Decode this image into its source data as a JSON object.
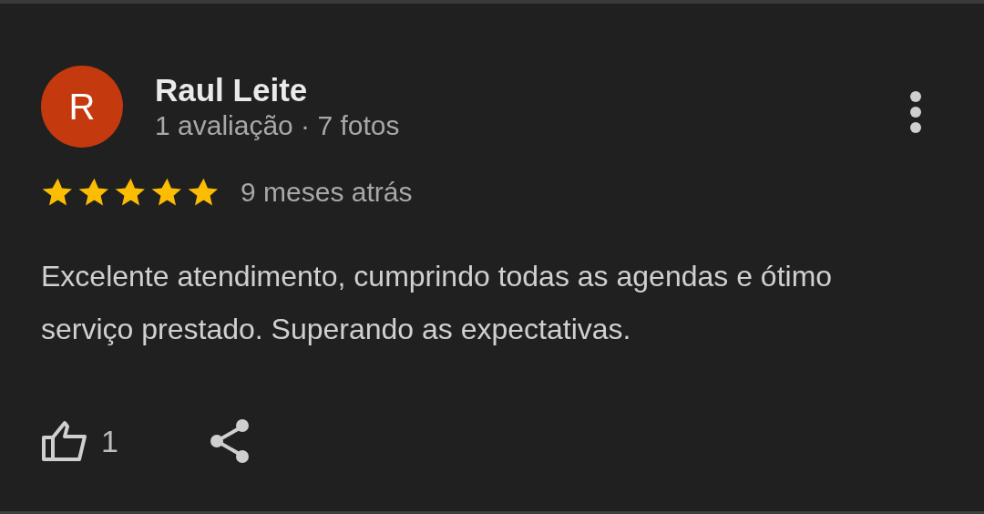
{
  "review": {
    "avatar_letter": "R",
    "author": "Raul Leite",
    "author_stats": "1 avaliação · 7 fotos",
    "stars": 5,
    "time": "9 meses atrás",
    "text": "Excelente atendimento, cumprindo todas as agendas e ótimo serviço prestado. Superando as expectativas.",
    "likes": "1"
  }
}
